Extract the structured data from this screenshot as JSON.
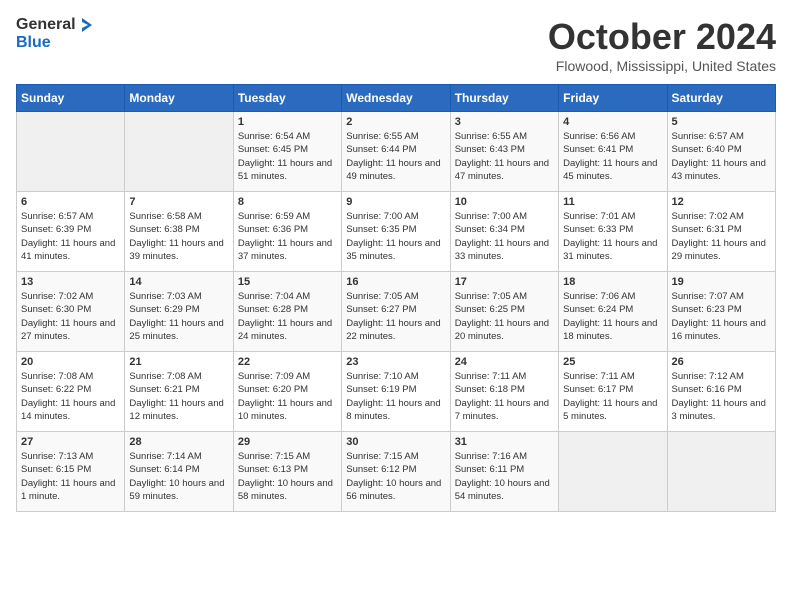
{
  "logo": {
    "general": "General",
    "blue": "Blue"
  },
  "title": "October 2024",
  "location": "Flowood, Mississippi, United States",
  "days_of_week": [
    "Sunday",
    "Monday",
    "Tuesday",
    "Wednesday",
    "Thursday",
    "Friday",
    "Saturday"
  ],
  "weeks": [
    [
      {
        "day": "",
        "info": ""
      },
      {
        "day": "",
        "info": ""
      },
      {
        "day": "1",
        "info": "Sunrise: 6:54 AM\nSunset: 6:45 PM\nDaylight: 11 hours and 51 minutes."
      },
      {
        "day": "2",
        "info": "Sunrise: 6:55 AM\nSunset: 6:44 PM\nDaylight: 11 hours and 49 minutes."
      },
      {
        "day": "3",
        "info": "Sunrise: 6:55 AM\nSunset: 6:43 PM\nDaylight: 11 hours and 47 minutes."
      },
      {
        "day": "4",
        "info": "Sunrise: 6:56 AM\nSunset: 6:41 PM\nDaylight: 11 hours and 45 minutes."
      },
      {
        "day": "5",
        "info": "Sunrise: 6:57 AM\nSunset: 6:40 PM\nDaylight: 11 hours and 43 minutes."
      }
    ],
    [
      {
        "day": "6",
        "info": "Sunrise: 6:57 AM\nSunset: 6:39 PM\nDaylight: 11 hours and 41 minutes."
      },
      {
        "day": "7",
        "info": "Sunrise: 6:58 AM\nSunset: 6:38 PM\nDaylight: 11 hours and 39 minutes."
      },
      {
        "day": "8",
        "info": "Sunrise: 6:59 AM\nSunset: 6:36 PM\nDaylight: 11 hours and 37 minutes."
      },
      {
        "day": "9",
        "info": "Sunrise: 7:00 AM\nSunset: 6:35 PM\nDaylight: 11 hours and 35 minutes."
      },
      {
        "day": "10",
        "info": "Sunrise: 7:00 AM\nSunset: 6:34 PM\nDaylight: 11 hours and 33 minutes."
      },
      {
        "day": "11",
        "info": "Sunrise: 7:01 AM\nSunset: 6:33 PM\nDaylight: 11 hours and 31 minutes."
      },
      {
        "day": "12",
        "info": "Sunrise: 7:02 AM\nSunset: 6:31 PM\nDaylight: 11 hours and 29 minutes."
      }
    ],
    [
      {
        "day": "13",
        "info": "Sunrise: 7:02 AM\nSunset: 6:30 PM\nDaylight: 11 hours and 27 minutes."
      },
      {
        "day": "14",
        "info": "Sunrise: 7:03 AM\nSunset: 6:29 PM\nDaylight: 11 hours and 25 minutes."
      },
      {
        "day": "15",
        "info": "Sunrise: 7:04 AM\nSunset: 6:28 PM\nDaylight: 11 hours and 24 minutes."
      },
      {
        "day": "16",
        "info": "Sunrise: 7:05 AM\nSunset: 6:27 PM\nDaylight: 11 hours and 22 minutes."
      },
      {
        "day": "17",
        "info": "Sunrise: 7:05 AM\nSunset: 6:25 PM\nDaylight: 11 hours and 20 minutes."
      },
      {
        "day": "18",
        "info": "Sunrise: 7:06 AM\nSunset: 6:24 PM\nDaylight: 11 hours and 18 minutes."
      },
      {
        "day": "19",
        "info": "Sunrise: 7:07 AM\nSunset: 6:23 PM\nDaylight: 11 hours and 16 minutes."
      }
    ],
    [
      {
        "day": "20",
        "info": "Sunrise: 7:08 AM\nSunset: 6:22 PM\nDaylight: 11 hours and 14 minutes."
      },
      {
        "day": "21",
        "info": "Sunrise: 7:08 AM\nSunset: 6:21 PM\nDaylight: 11 hours and 12 minutes."
      },
      {
        "day": "22",
        "info": "Sunrise: 7:09 AM\nSunset: 6:20 PM\nDaylight: 11 hours and 10 minutes."
      },
      {
        "day": "23",
        "info": "Sunrise: 7:10 AM\nSunset: 6:19 PM\nDaylight: 11 hours and 8 minutes."
      },
      {
        "day": "24",
        "info": "Sunrise: 7:11 AM\nSunset: 6:18 PM\nDaylight: 11 hours and 7 minutes."
      },
      {
        "day": "25",
        "info": "Sunrise: 7:11 AM\nSunset: 6:17 PM\nDaylight: 11 hours and 5 minutes."
      },
      {
        "day": "26",
        "info": "Sunrise: 7:12 AM\nSunset: 6:16 PM\nDaylight: 11 hours and 3 minutes."
      }
    ],
    [
      {
        "day": "27",
        "info": "Sunrise: 7:13 AM\nSunset: 6:15 PM\nDaylight: 11 hours and 1 minute."
      },
      {
        "day": "28",
        "info": "Sunrise: 7:14 AM\nSunset: 6:14 PM\nDaylight: 10 hours and 59 minutes."
      },
      {
        "day": "29",
        "info": "Sunrise: 7:15 AM\nSunset: 6:13 PM\nDaylight: 10 hours and 58 minutes."
      },
      {
        "day": "30",
        "info": "Sunrise: 7:15 AM\nSunset: 6:12 PM\nDaylight: 10 hours and 56 minutes."
      },
      {
        "day": "31",
        "info": "Sunrise: 7:16 AM\nSunset: 6:11 PM\nDaylight: 10 hours and 54 minutes."
      },
      {
        "day": "",
        "info": ""
      },
      {
        "day": "",
        "info": ""
      }
    ]
  ]
}
